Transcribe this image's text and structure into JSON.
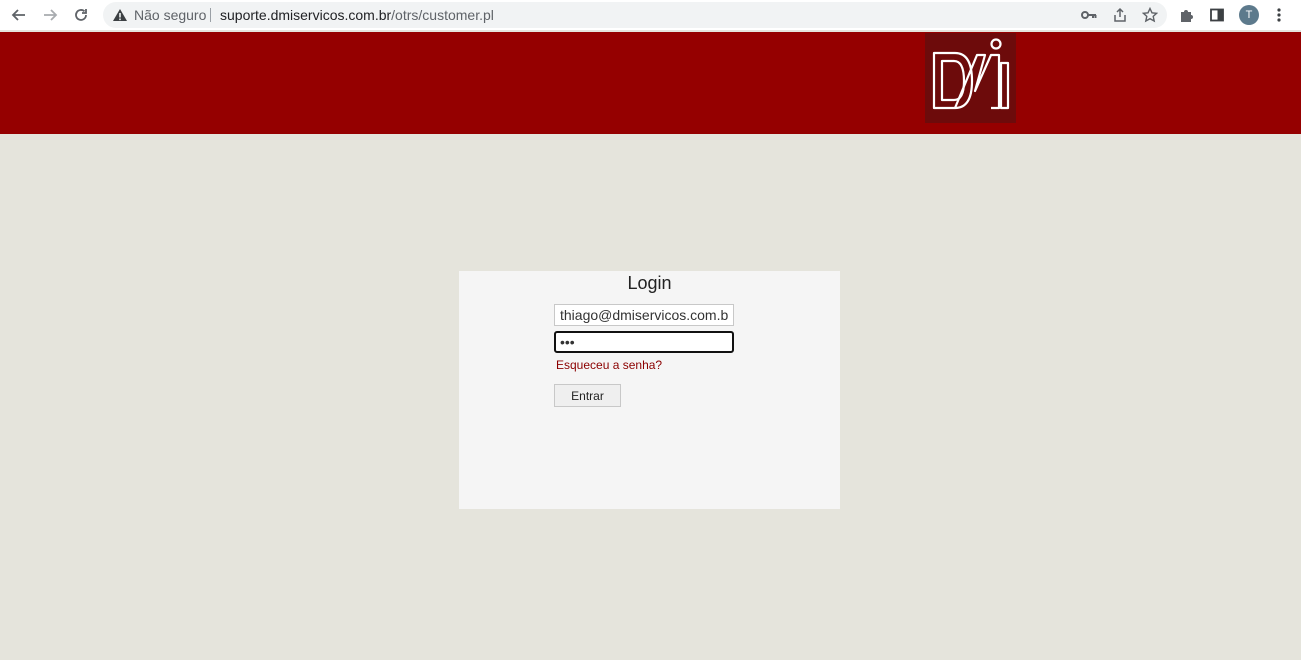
{
  "browser": {
    "security_label": "Não seguro",
    "url_host": "suporte.dmiservicos.com.br",
    "url_path": "/otrs/customer.pl",
    "profile_initial": "T"
  },
  "icons": {
    "back": "arrow-left-icon",
    "forward": "arrow-right-icon",
    "reload": "reload-icon",
    "warning": "warning-icon",
    "key": "key-icon",
    "share": "share-icon",
    "bookmark": "star-icon",
    "extensions": "puzzle-icon",
    "side_panel": "side-panel-icon",
    "menu": "kebab-menu-icon"
  },
  "colors": {
    "banner": "#950000",
    "logo_bg": "#6d0b0b",
    "page_bg": "#e5e4dc",
    "link": "#8b0000"
  },
  "login": {
    "title": "Login",
    "username_value": "thiago@dmiservicos.com.br",
    "password_value": "•••",
    "forgot_link": "Esqueceu a senha?",
    "submit_label": "Entrar"
  }
}
